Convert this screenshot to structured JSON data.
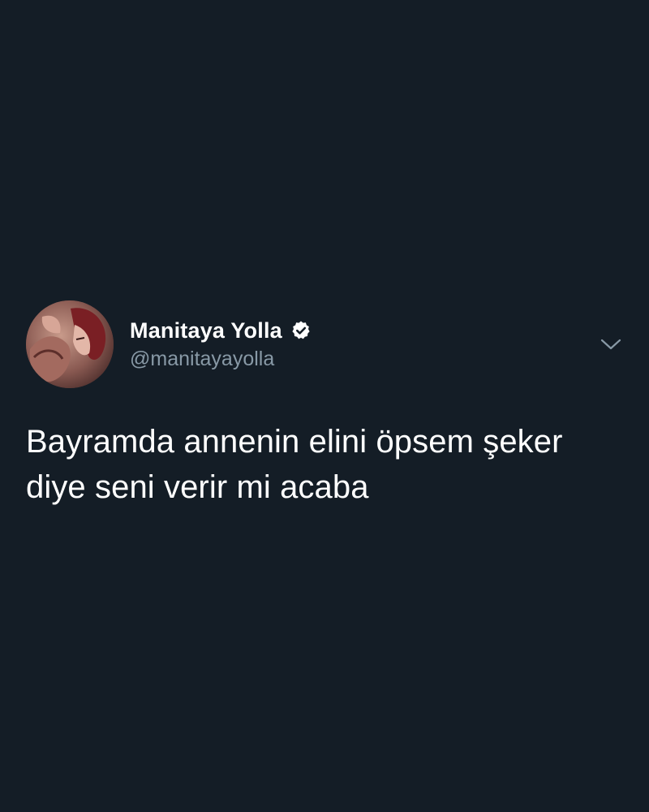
{
  "tweet": {
    "author": {
      "display_name": "Manitaya Yolla",
      "handle": "@manitayayolla",
      "verified": true
    },
    "text": "Bayramda annenin elini öpsem şeker\ndiye seni verir mi acaba",
    "menu_icon": "chevron-down-icon",
    "avatar_icon": "profile-avatar"
  },
  "colors": {
    "background": "#141d26",
    "primary_text": "#ffffff",
    "secondary_text": "#8899a6"
  }
}
